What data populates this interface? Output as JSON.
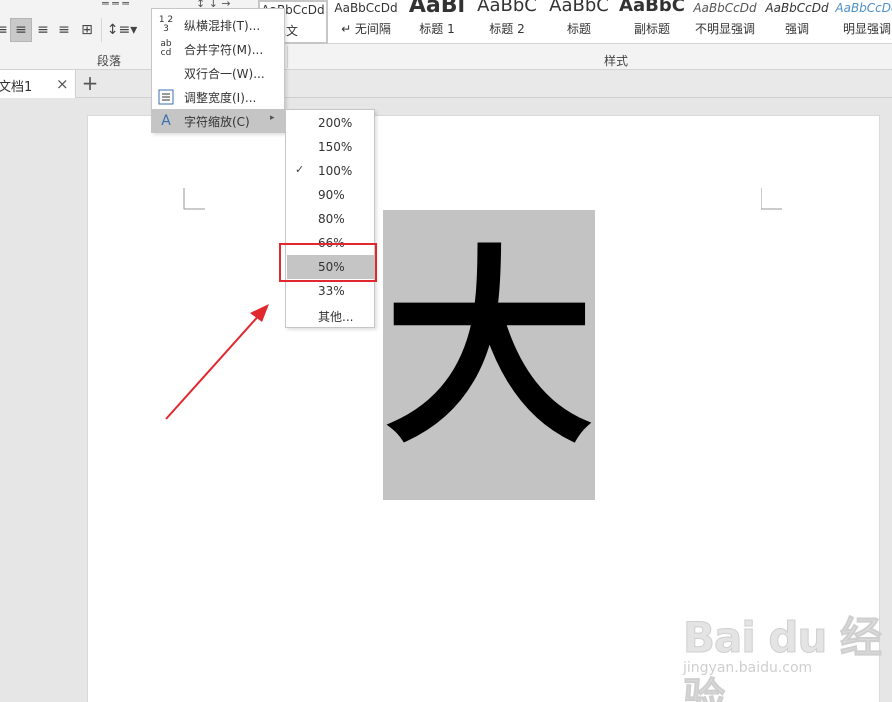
{
  "ribbon": {
    "paragraph_group_label": "段落",
    "styles_group_label": "样式",
    "styles": [
      {
        "sample": "AaBbCcDd",
        "name": "正文",
        "selected": true
      },
      {
        "sample": "AaBbCcDd",
        "name": "↵ 无间隔",
        "selected": false
      },
      {
        "sample": "AaBl",
        "name": "标题 1",
        "selected": false
      },
      {
        "sample": "AaBbC",
        "name": "标题 2",
        "selected": false
      },
      {
        "sample": "AaBbC",
        "name": "标题",
        "selected": false
      },
      {
        "sample": "AaBbC",
        "name": "副标题",
        "selected": false
      },
      {
        "sample": "AaBbCcDd",
        "name": "不明显强调",
        "selected": false
      },
      {
        "sample": "AaBbCcDd",
        "name": "强调",
        "selected": false
      },
      {
        "sample": "AaBbCcDd",
        "name": "明显强调",
        "selected": false
      }
    ]
  },
  "doc_tab": {
    "label": "文档1",
    "close": "×",
    "new": "+"
  },
  "menu": {
    "items": [
      {
        "icon": "vertical-horizontal-icon",
        "icon_text": "1 2 3",
        "label": "纵横混排(T)..."
      },
      {
        "icon": "combine-characters-icon",
        "icon_text": "ab cd",
        "label": "合并字符(M)..."
      },
      {
        "icon": "",
        "icon_text": "",
        "label": "双行合一(W)..."
      },
      {
        "icon": "fit-text-icon",
        "icon_text": "",
        "label": "调整宽度(I)..."
      },
      {
        "icon": "character-scaling-icon",
        "icon_text": "A",
        "label": "字符缩放(C)",
        "submenu_arrow": "▸"
      }
    ]
  },
  "submenu": {
    "checked_mark": "✓",
    "items": [
      {
        "label": "200%",
        "checked": false
      },
      {
        "label": "150%",
        "checked": false
      },
      {
        "label": "100%",
        "checked": true
      },
      {
        "label": "90%",
        "checked": false
      },
      {
        "label": "80%",
        "checked": false
      },
      {
        "label": "66%",
        "checked": false
      },
      {
        "label": "50%",
        "checked": false,
        "hovered": true
      },
      {
        "label": "33%",
        "checked": false
      },
      {
        "label": "其他...",
        "checked": false
      }
    ]
  },
  "document": {
    "character": "大"
  },
  "watermark": {
    "logo": "Bai du 经验",
    "url": "jingyan.baidu.com"
  },
  "colors": {
    "annotation_red": "#e0282e",
    "menu_hover": "#c5c5c5",
    "char_highlight": "#c3c3c3"
  }
}
